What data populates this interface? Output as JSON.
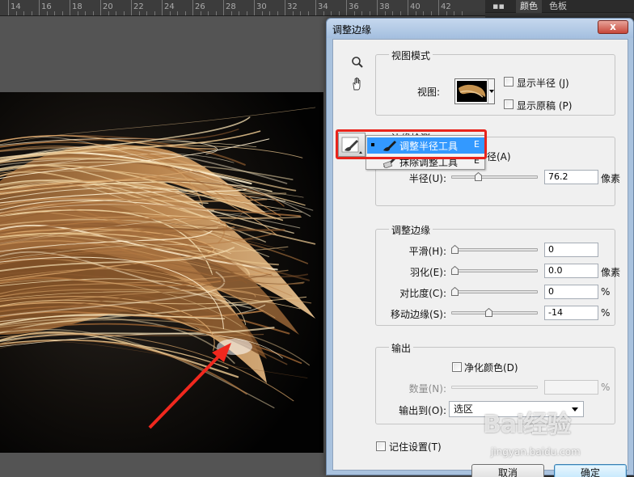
{
  "ruler": {
    "labels": [
      "14",
      "16",
      "18",
      "20",
      "22",
      "24",
      "26",
      "28",
      "30",
      "32",
      "34",
      "36",
      "38",
      "40",
      "42"
    ]
  },
  "panel": {
    "tab_color": "颜色",
    "tab_swatches": "色板"
  },
  "dialog": {
    "title": "调整边缘",
    "close": "x",
    "view_mode": {
      "legend": "视图模式",
      "view_label": "视图:",
      "show_radius": "显示半径 (J)",
      "show_original": "显示原稿 (P)"
    },
    "edge_detection": {
      "legend": "边缘检测",
      "smart_radius_suffix": "径(A)",
      "radius_label": "半径(U):",
      "radius_value": "76.2",
      "radius_unit": "像素",
      "radius_fraction": 0.3
    },
    "adjust_edge": {
      "legend": "调整边缘",
      "smooth_label": "平滑(H):",
      "smooth_value": "0",
      "smooth_fraction": 0.0,
      "feather_label": "羽化(E):",
      "feather_value": "0.0",
      "feather_unit": "像素",
      "feather_fraction": 0.0,
      "contrast_label": "对比度(C):",
      "contrast_value": "0",
      "contrast_unit": "%",
      "contrast_fraction": 0.0,
      "shift_label": "移动边缘(S):",
      "shift_value": "-14",
      "shift_unit": "%",
      "shift_fraction": 0.43
    },
    "output": {
      "legend": "输出",
      "decontaminate": "净化颜色(D)",
      "amount_label": "数量(N):",
      "amount_unit": "%",
      "output_to_label": "输出到(O):",
      "output_to_value": "选区"
    },
    "remember": "记住设置(T)",
    "cancel": "取消",
    "ok": "确定"
  },
  "flyout": {
    "items": [
      {
        "label": "调整半径工具",
        "key": "E"
      },
      {
        "label": "抹除调整工具",
        "key": "E"
      }
    ]
  },
  "watermark": {
    "logo": "Bai经验",
    "url": "jingyan.baidu.com"
  },
  "colors": {
    "highlight": "#e8241c",
    "selection": "#3399ff",
    "arrow": "#f0281e"
  }
}
